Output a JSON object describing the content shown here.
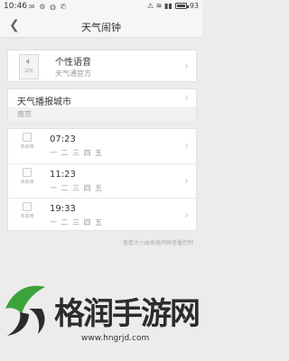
{
  "status_bar": {
    "time": "10:46",
    "left_icons": "✉ ⚙ ◍ ✆",
    "right_icons": "⚠ ≋ ▮▮",
    "battery": "93"
  },
  "nav": {
    "back_icon": "back-arrow-icon",
    "title": "天气闹钟"
  },
  "voice": {
    "icon_label": "试听",
    "title": "个性语音",
    "subtitle": "天气通官方"
  },
  "city": {
    "title": "天气播报城市",
    "value": "南京"
  },
  "alarms": [
    {
      "status": "未启用",
      "time": "07:23",
      "days": "一 二 三 四 五"
    },
    {
      "status": "未启用",
      "time": "11:23",
      "days": "一 二 三 四 五"
    },
    {
      "status": "未启用",
      "time": "19:33",
      "days": "一 二 三 四 五"
    }
  ],
  "hint": "查看大小由系统闹钟音量控制",
  "watermark": {
    "text": "格润手游网",
    "url": "www.hngrjd.com"
  },
  "colors": {
    "background": "#ececec",
    "card": "#ffffff",
    "logo_green": "#3aa33a"
  }
}
